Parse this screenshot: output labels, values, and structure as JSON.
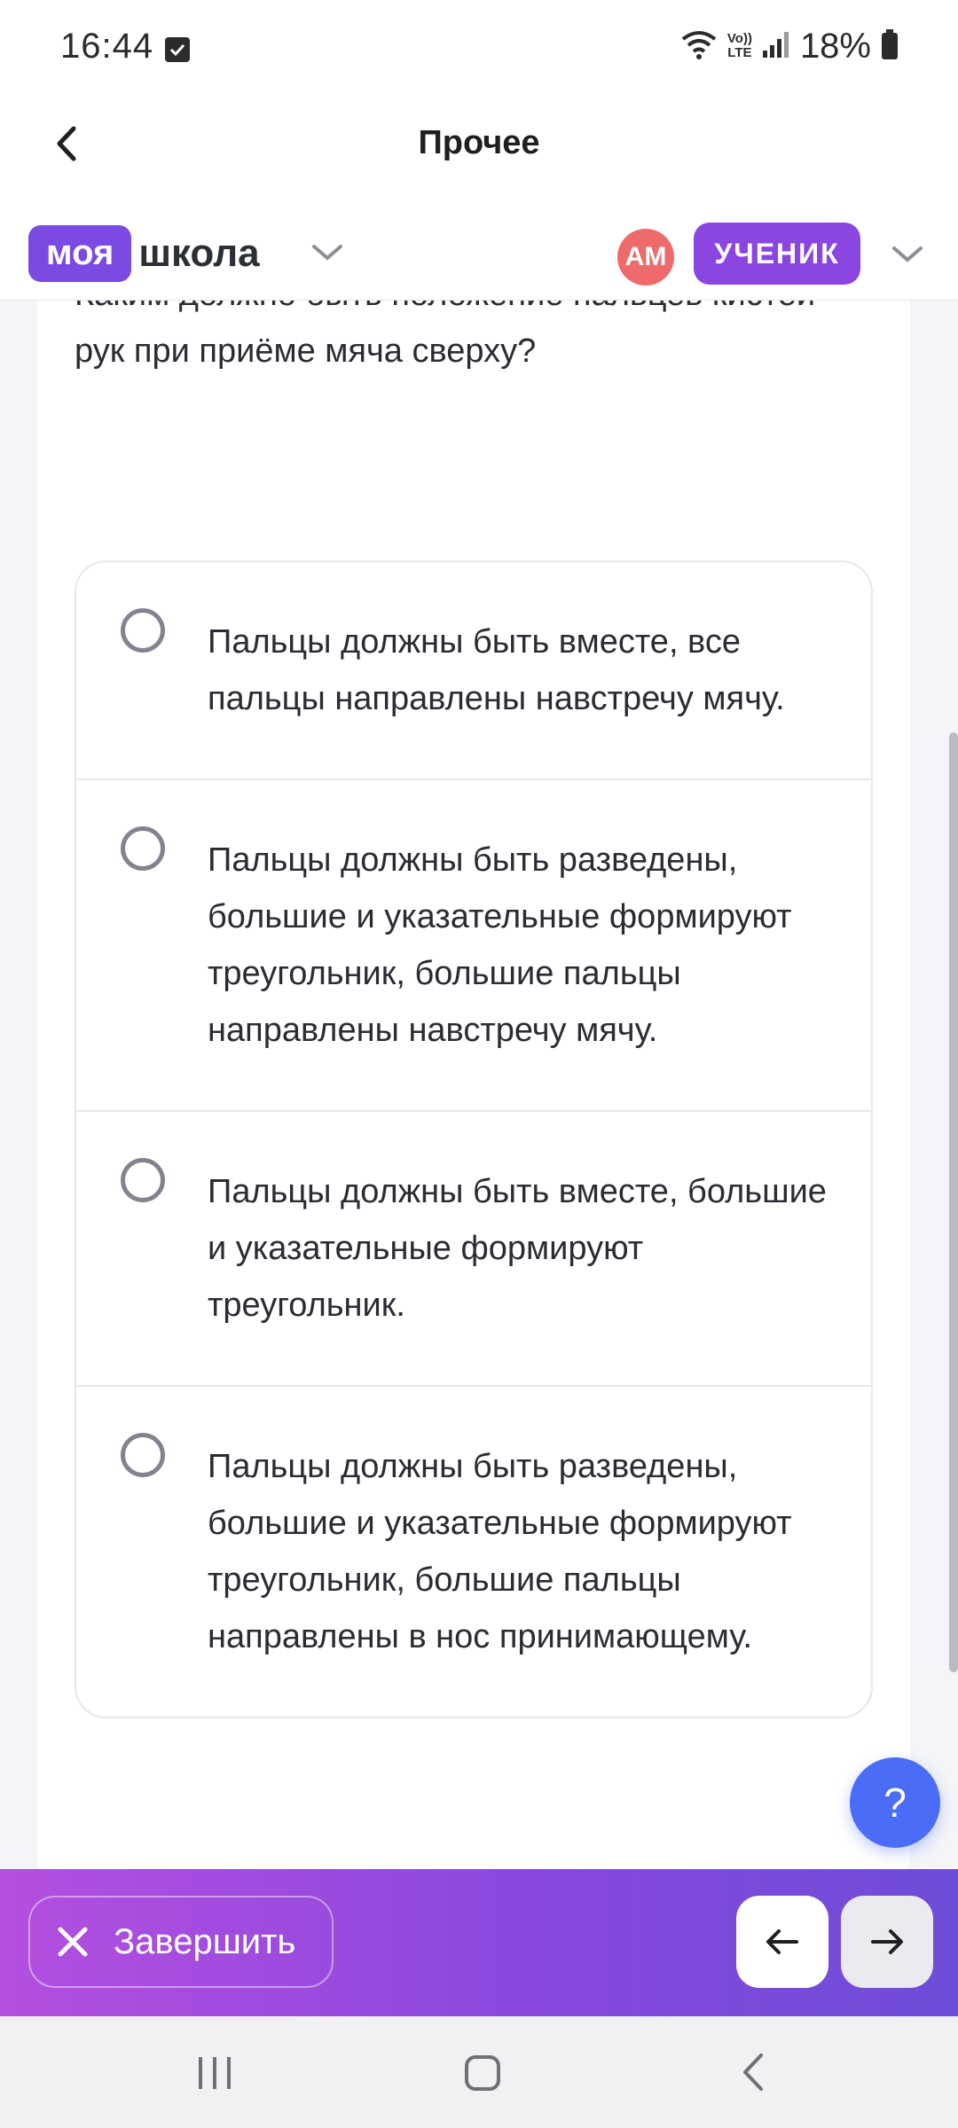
{
  "status_bar": {
    "time": "16:44",
    "battery": "18%",
    "icons": [
      "check-box-icon",
      "wifi-icon",
      "volte-icon",
      "signal-icon",
      "battery-icon"
    ],
    "volte_label_top": "Vo))",
    "volte_label_bottom": "LTE"
  },
  "header": {
    "title": "Прочее",
    "back_icon": "chevron-left-icon"
  },
  "brand": {
    "part1": "моя",
    "part2": "школа",
    "avatar_initials": "АМ",
    "role": "УЧЕНИК"
  },
  "question": {
    "text": "Каким должно быть положение пальцев кистей рук при приёме мяча сверху?"
  },
  "options": [
    {
      "text": "Пальцы должны быть вместе, все пальцы направлены навстречу мячу."
    },
    {
      "text": "Пальцы должны быть разведены, большие и указательные формируют треугольник, большие пальцы направлены навстречу мячу."
    },
    {
      "text": "Пальцы должны быть вместе, большие и указательные формируют треугольник."
    },
    {
      "text": "Пальцы должны быть разведены, большие и указательные формируют треугольник, большие пальцы направлены в нос принимающему."
    }
  ],
  "help": {
    "label": "?"
  },
  "actions": {
    "finish_label": "Завершить",
    "prev_icon": "arrow-left-icon",
    "next_icon": "arrow-right-icon"
  },
  "colors": {
    "brand_purple": "#7b4ae3",
    "role_purple": "#8b45e0",
    "avatar_red": "#ef6a6a",
    "help_blue": "#4a6cf7",
    "gradient_start": "#b44fe0",
    "gradient_end": "#6d4dd8"
  }
}
